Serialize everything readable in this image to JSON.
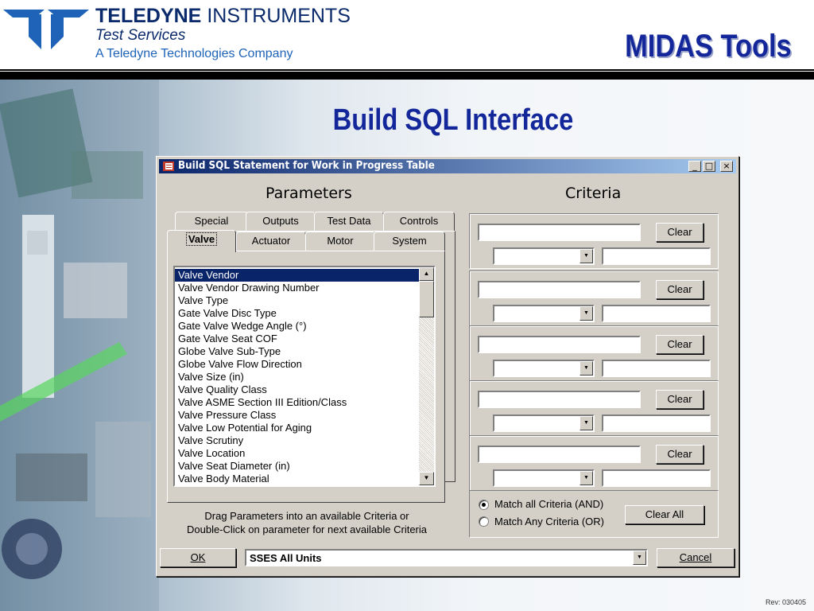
{
  "header": {
    "company_bold": "TELEDYNE",
    "company_rest": "INSTRUMENTS",
    "division": "Test Services",
    "parent": "A Teledyne Technologies Company",
    "product_title": "MIDAS Tools"
  },
  "slide": {
    "title": "Build SQL Interface",
    "revision": "Rev: 030405"
  },
  "window": {
    "title": "Build SQL Statement for Work in Progress Table",
    "minimize_glyph": "_",
    "maximize_glyph": "□",
    "close_glyph": "×"
  },
  "parameters": {
    "heading": "Parameters",
    "tabs_back": [
      "Special",
      "Outputs",
      "Test Data",
      "Controls"
    ],
    "tabs_front": [
      "Valve",
      "Actuator",
      "Motor",
      "System"
    ],
    "active_tab": "Valve",
    "list": [
      "Valve Vendor",
      "Valve Vendor Drawing Number",
      "Valve Type",
      "Gate Valve Disc Type",
      "Gate Valve Wedge Angle (°)",
      "Gate Valve Seat COF",
      "Globe Valve Sub-Type",
      "Globe Valve Flow Direction",
      "Valve Size (in)",
      "Valve Quality Class",
      "Valve ASME Section III Edition/Class",
      "Valve Pressure Class",
      "Valve Low Potential for Aging",
      "Valve Scrutiny",
      "Valve Location",
      "Valve Seat Diameter (in)",
      "Valve Body Material"
    ],
    "selected": "Valve Vendor",
    "hint_line1": "Drag Parameters into an available Criteria or",
    "hint_line2": "Double-Click on parameter for next available Criteria"
  },
  "criteria": {
    "heading": "Criteria",
    "clear_label": "Clear",
    "rows": [
      {
        "field": "",
        "operator": "",
        "value": ""
      },
      {
        "field": "",
        "operator": "",
        "value": ""
      },
      {
        "field": "",
        "operator": "",
        "value": ""
      },
      {
        "field": "",
        "operator": "",
        "value": ""
      },
      {
        "field": "",
        "operator": "",
        "value": ""
      }
    ],
    "match_all_label": "Match all Criteria (AND)",
    "match_any_label": "Match Any Criteria (OR)",
    "match_mode": "AND",
    "clear_all_label": "Clear All"
  },
  "footer": {
    "ok_label": "OK",
    "unit_selected": "SSES All Units",
    "cancel_label": "Cancel"
  }
}
